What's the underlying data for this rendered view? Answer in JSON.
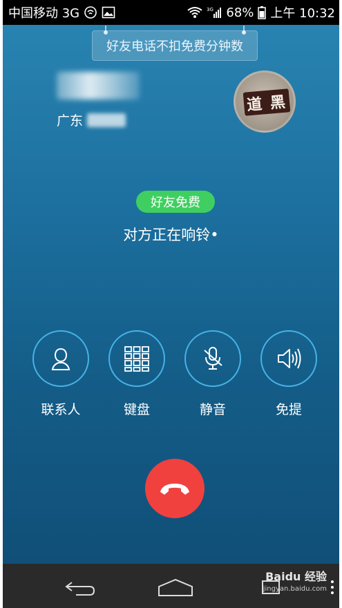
{
  "status_bar": {
    "carrier": "中国移动 3G",
    "network": "3G",
    "battery": "68%",
    "time": "上午 10:32"
  },
  "tip": {
    "text": "好友电话不扣免费分钟数"
  },
  "contact": {
    "location_prefix": "广东"
  },
  "avatar": {
    "plaque_text": "道 黑"
  },
  "badge": {
    "text": "好友免费"
  },
  "call_status": {
    "text": "对方正在响铃•"
  },
  "actions": [
    {
      "label": "联系人",
      "icon": "contact-icon"
    },
    {
      "label": "键盘",
      "icon": "keypad-icon"
    },
    {
      "label": "静音",
      "icon": "mute-mic-icon"
    },
    {
      "label": "免提",
      "icon": "speaker-icon"
    }
  ],
  "nav": {
    "watermark": "Baidu 经验",
    "watermark_sub": "jingyan.baidu.com"
  },
  "colors": {
    "accent_ring": "#46b3e6",
    "hangup": "#f0413f",
    "badge": "#3fcf60"
  }
}
